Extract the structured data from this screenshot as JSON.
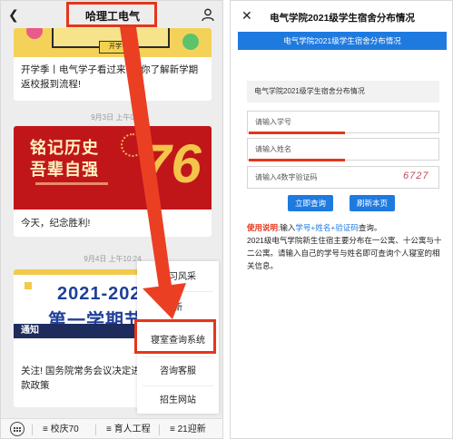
{
  "left": {
    "header_title": "哈理工电气",
    "articles": [
      {
        "image_caption": "开学",
        "title": "开学季丨电气学子看过来~带你了解新学期返校报到流程!"
      },
      {
        "date": "9月3日 上午0",
        "image_text_line1": "铭记历史",
        "image_text_line2": "吾辈自强",
        "image_number": "76",
        "title": "今天，纪念胜利!"
      },
      {
        "date": "9月4日 上午10:24",
        "image_year": "2021-2022",
        "image_term": "第一学期节假",
        "image_notice": "通知",
        "title": "关注! 国务院常务会议决定进一步 家助学贷款政策"
      }
    ],
    "popup_menu": [
      "学习风采",
      "新",
      "寝室查询系统",
      "咨询客服",
      "招生网站"
    ],
    "bottom_tabs": [
      "≡ 校庆70",
      "≡ 育人工程",
      "≡ 21迎新"
    ]
  },
  "right": {
    "page_title": "电气学院2021级学生宿舍分布情况",
    "banner": "电气学院2021级学生宿舍分布情况",
    "section_label": "电气学院2021级学生宿舍分布情况",
    "student_id_placeholder": "请输入学号",
    "name_placeholder": "请输入姓名",
    "captcha_placeholder": "请输入4数字验证码",
    "captcha_code": "6727",
    "query_button": "立即查询",
    "refresh_button": "刷新本页",
    "usage": {
      "label": "使用说明",
      "colon": ":输入",
      "hint": "学号+姓名+验证码",
      "tail": "查询。",
      "line2": "2021级电气学院新生住宿主要分布在一公寓、十公寓与十二公寓。请输入自己的学号与姓名即可查询个人寝室的相关信息。"
    }
  },
  "colors": {
    "highlight": "#e4361b",
    "accent_blue": "#1f7ae0",
    "wechat_bg": "#ededed"
  },
  "icons": [
    "back-icon",
    "user-icon",
    "close-icon",
    "keyboard-icon",
    "arrow-annotation"
  ]
}
